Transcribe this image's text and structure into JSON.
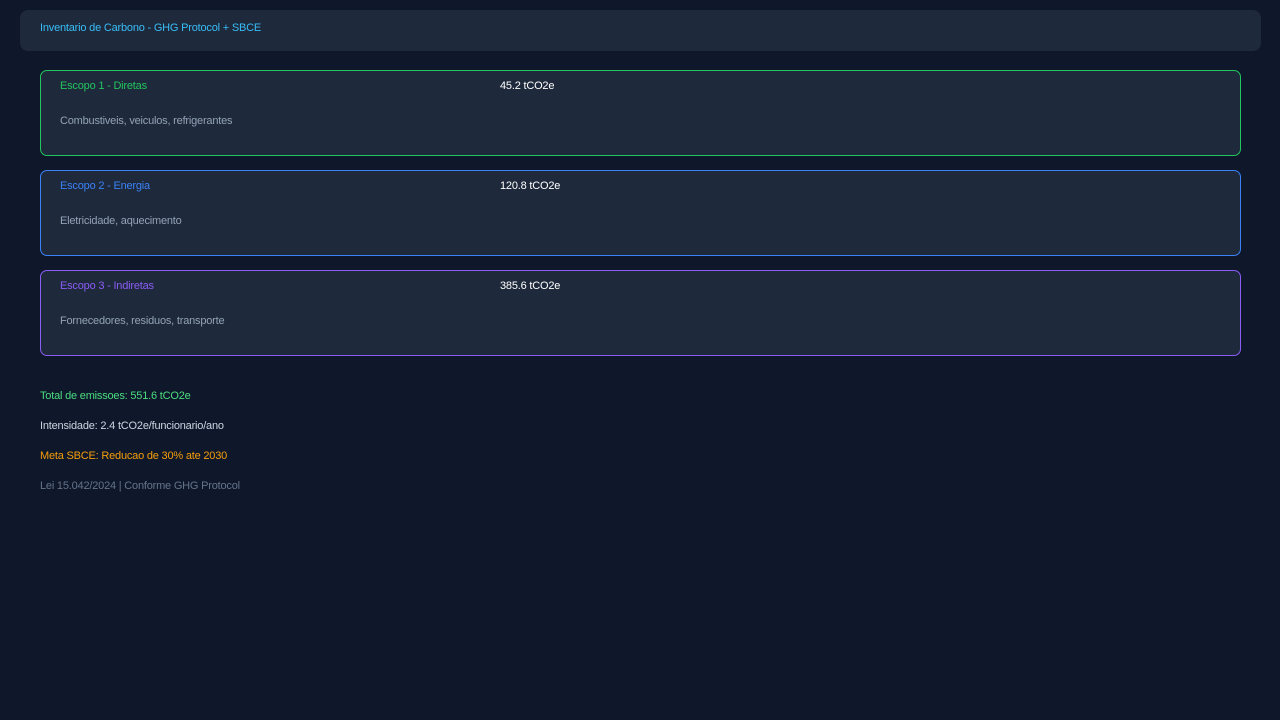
{
  "header": {
    "title": "Inventario de Carbono - GHG Protocol + SBCE"
  },
  "scopes": [
    {
      "name": "Escopo 1 - Diretas",
      "value": "45.2 tCO2e",
      "description": "Combustiveis, veiculos, refrigerantes",
      "color": "#22c55e"
    },
    {
      "name": "Escopo 2 - Energia",
      "value": "120.8 tCO2e",
      "description": "Eletricidade, aquecimento",
      "color": "#3b82f6"
    },
    {
      "name": "Escopo 3 - Indiretas",
      "value": "385.6 tCO2e",
      "description": "Fornecedores, residuos, transporte",
      "color": "#8b5cf6"
    }
  ],
  "summary": {
    "total": "Total de emissoes: 551.6 tCO2e",
    "intensity": "Intensidade: 2.4 tCO2e/funcionario/ano",
    "goal": "Meta SBCE: Reducao de 30% ate 2030",
    "compliance": "Lei 15.042/2024 | Conforme GHG Protocol"
  },
  "colors": {
    "background": "#0f172a",
    "panel": "#1e293b",
    "header_text": "#38bdf8",
    "total": "#4ade80",
    "intensity": "#cbd5e1",
    "goal": "#f59e0b",
    "compliance": "#64748b"
  }
}
